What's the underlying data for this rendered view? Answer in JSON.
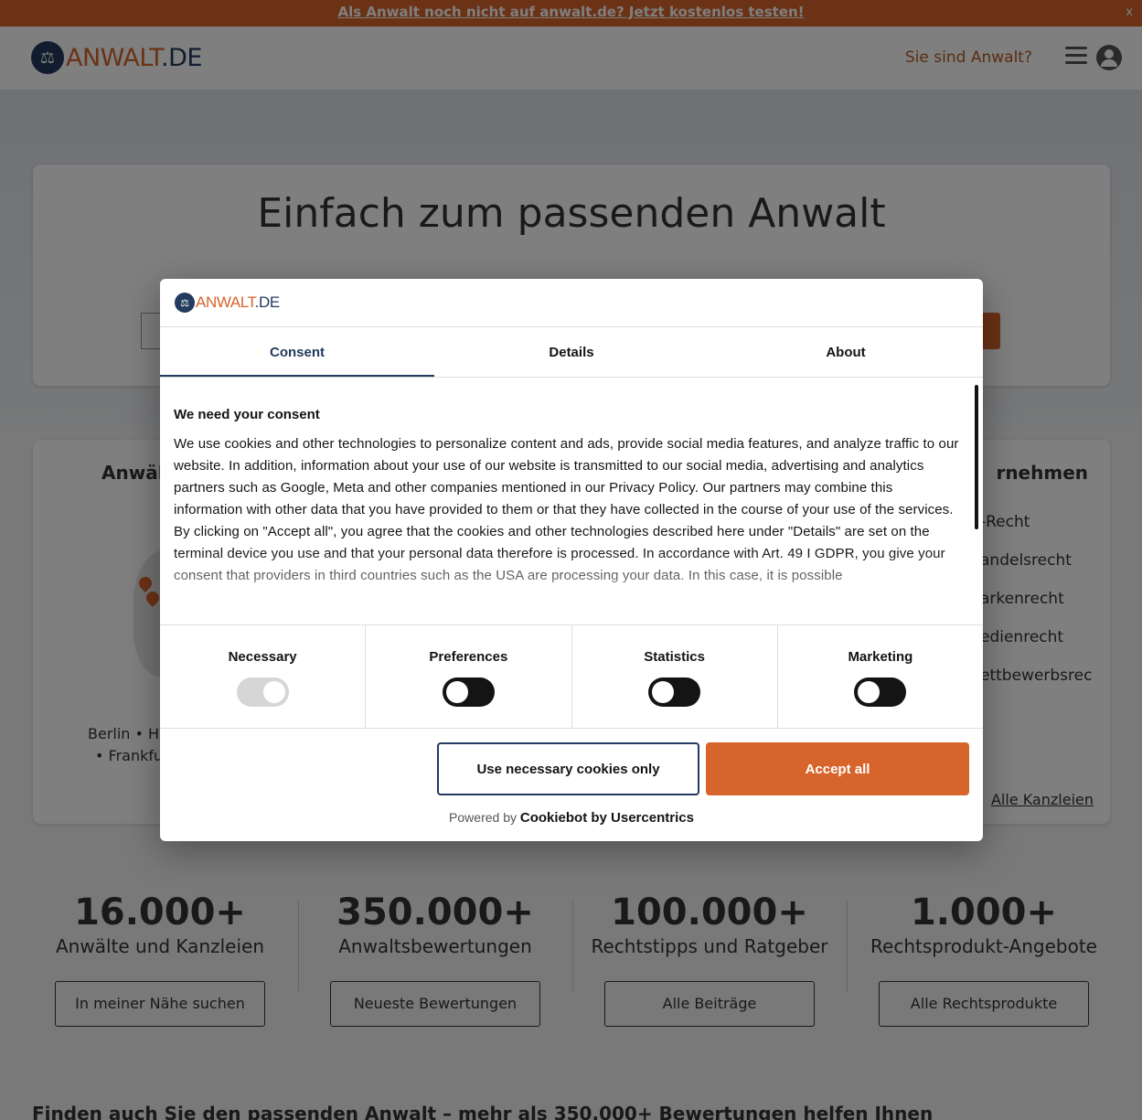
{
  "banner": {
    "text": "Als Anwalt noch nicht auf anwalt.de? Jetzt kostenlos testen!",
    "close": "x"
  },
  "header": {
    "logo_part1": "ANWALT",
    "logo_part2": ".DE",
    "lawyer_link": "Sie sind Anwalt?",
    "menu_icon": "hamburger-icon",
    "user_icon": "user-icon"
  },
  "hero": {
    "title": "Einfach zum passenden Anwalt"
  },
  "cards": {
    "left_title": "Anwält",
    "cities_line1": "Berlin • Ha",
    "cities_line2": "• Frankfur",
    "right_title": "rnehmen",
    "right_items": [
      "-Recht",
      "andelsrecht",
      "arkenrecht",
      "edienrecht",
      "ettbewerbsrec"
    ],
    "alle_kanzleien": "Alle Kanzleien"
  },
  "stats": [
    {
      "num": "16.000+",
      "label": "Anwälte und Kanzleien",
      "button": "In meiner Nähe suchen"
    },
    {
      "num": "350.000+",
      "label": "Anwaltsbewertungen",
      "button": "Neueste Bewertungen"
    },
    {
      "num": "100.000+",
      "label": "Rechtstipps und Ratgeber",
      "button": "Alle Beiträge"
    },
    {
      "num": "1.000+",
      "label": "Rechtsprodukt-Angebote",
      "button": "Alle Rechtsprodukte"
    }
  ],
  "bottom_heading": "Finden auch Sie den passenden Anwalt – mehr als 350.000+ Bewertungen helfen Ihnen",
  "dialog": {
    "logo_part1": "ANWALT",
    "logo_part2": ".DE",
    "tabs": [
      "Consent",
      "Details",
      "About"
    ],
    "heading": "We need your consent",
    "para1": "We use cookies and other technologies to personalize content and ads, provide social media features, and analyze traffic to our website. In addition, information about your use of our website is transmitted to our social media, advertising and analytics partners such as Google, Meta and other companies mentioned in our Privacy Policy. Our partners may combine this information with other data that you have provided to them or that they have collected in the course of your use of the services.",
    "para2": "By clicking on \"Accept all\", you agree that the cookies and other technologies described here under \"Details\" are set on the terminal device you use and that your personal data therefore is processed. In accordance with Art. 49 I GDPR, you give your consent that providers in third countries such as the USA are processing your data. In this case, it is possible",
    "toggles": [
      {
        "label": "Necessary",
        "state": "on-disabled"
      },
      {
        "label": "Preferences",
        "state": "off"
      },
      {
        "label": "Statistics",
        "state": "off"
      },
      {
        "label": "Marketing",
        "state": "off"
      }
    ],
    "btn_necessary": "Use necessary cookies only",
    "btn_accept": "Accept all",
    "powered_prefix": "Powered by",
    "powered_brand": "Cookiebot by Usercentrics"
  },
  "colors": {
    "accent": "#d7642b",
    "navy": "#233b5e"
  }
}
